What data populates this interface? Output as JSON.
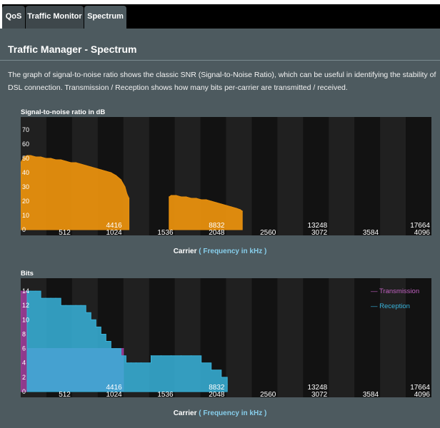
{
  "tabs": [
    {
      "label": "QoS",
      "active": false
    },
    {
      "label": "Traffic Monitor",
      "active": false
    },
    {
      "label": "Spectrum",
      "active": true
    }
  ],
  "page_title": "Traffic Manager - Spectrum",
  "description": "The graph of signal-to-noise ratio shows the classic SNR (Signal-to-Noise Ratio), which can be useful in identifying the stability of DSL connection. Transmission / Reception shows how many bits per-carrier are transmitted / received.",
  "colors": {
    "snr": "#e8900e",
    "transmission": "#a43fa0",
    "reception": "#38b4dc",
    "freq_text": "#87ceeb"
  },
  "snr_chart": {
    "title": "Signal-to-noise ratio in dB",
    "caption_prefix": "Carrier",
    "caption_freq": "( Frequency in kHz )"
  },
  "bits_chart": {
    "title": "Bits",
    "caption_prefix": "Carrier",
    "caption_freq": "( Frequency in kHz )",
    "legend": {
      "transmission": "Transmission",
      "reception": "Reception"
    }
  },
  "chart_data": [
    {
      "type": "area",
      "title": "Signal-to-noise ratio in dB",
      "xlabel": "Carrier ( Frequency in kHz )",
      "ylabel": "",
      "xlim": [
        0,
        4096
      ],
      "ylim": [
        0,
        75
      ],
      "y_ticks": [
        "0",
        "10",
        "20",
        "30",
        "40",
        "50",
        "60",
        "70"
      ],
      "x_ticks": [
        "512",
        "1024",
        "1536",
        "2048",
        "2560",
        "3072",
        "3584",
        "4096"
      ],
      "freq_ticks": [
        {
          "carrier": 1024,
          "label": "4416"
        },
        {
          "carrier": 2048,
          "label": "8832"
        },
        {
          "carrier": 3072,
          "label": "13248"
        },
        {
          "carrier": 4096,
          "label": "17664"
        }
      ],
      "grid": true,
      "series": [
        {
          "x": [
            0,
            32,
            64,
            100,
            150,
            200,
            250,
            300,
            350,
            400,
            450,
            500,
            550,
            600,
            650,
            700,
            750,
            800,
            850,
            900,
            950,
            1000,
            1040,
            1060,
            1080
          ],
          "y": [
            47,
            51,
            52,
            52,
            51,
            51,
            50,
            50,
            49,
            49,
            48,
            47,
            47,
            46,
            45,
            44,
            43,
            42,
            41,
            40,
            38,
            35,
            30,
            25,
            22
          ]
        },
        {
          "x": [
            1480,
            1500,
            1550,
            1600,
            1650,
            1700,
            1750,
            1800,
            1850,
            1900,
            1950,
            2000,
            2050,
            2100,
            2150,
            2190,
            2210
          ],
          "y": [
            23,
            24,
            24,
            23,
            23,
            22,
            22,
            21,
            21,
            20,
            19,
            18,
            17,
            16,
            15,
            14,
            13
          ]
        }
      ]
    },
    {
      "type": "area",
      "title": "Bits",
      "xlabel": "Carrier ( Frequency in kHz )",
      "ylabel": "",
      "xlim": [
        0,
        4096
      ],
      "ylim": [
        0,
        15
      ],
      "y_ticks": [
        "0",
        "2",
        "4",
        "6",
        "8",
        "10",
        "12",
        "14"
      ],
      "x_ticks": [
        "512",
        "1024",
        "1536",
        "2048",
        "2560",
        "3072",
        "3584",
        "4096"
      ],
      "freq_ticks": [
        {
          "carrier": 1024,
          "label": "4416"
        },
        {
          "carrier": 2048,
          "label": "8832"
        },
        {
          "carrier": 3072,
          "label": "13248"
        },
        {
          "carrier": 4096,
          "label": "17664"
        }
      ],
      "grid": true,
      "legend": "top-right",
      "series": [
        {
          "name": "Transmission",
          "x": [
            0,
            32,
            64,
            1024,
            1024
          ],
          "y": [
            14,
            14,
            6,
            6,
            0
          ]
        },
        {
          "name": "Reception",
          "x": [
            64,
            100,
            150,
            200,
            250,
            300,
            350,
            400,
            450,
            500,
            550,
            600,
            650,
            700,
            750,
            800,
            850,
            900,
            950,
            1000,
            1050,
            1100,
            1150,
            1200,
            1300,
            1400,
            1500,
            1600,
            1700,
            1800,
            1900,
            2000,
            2060
          ],
          "y": [
            14,
            14,
            14,
            13,
            13,
            13,
            13,
            12,
            12,
            12,
            12,
            12,
            11,
            10,
            9,
            8,
            7,
            6,
            6,
            5,
            4,
            4,
            4,
            4,
            5,
            5,
            5,
            5,
            5,
            4,
            3,
            2,
            1
          ]
        }
      ]
    }
  ]
}
